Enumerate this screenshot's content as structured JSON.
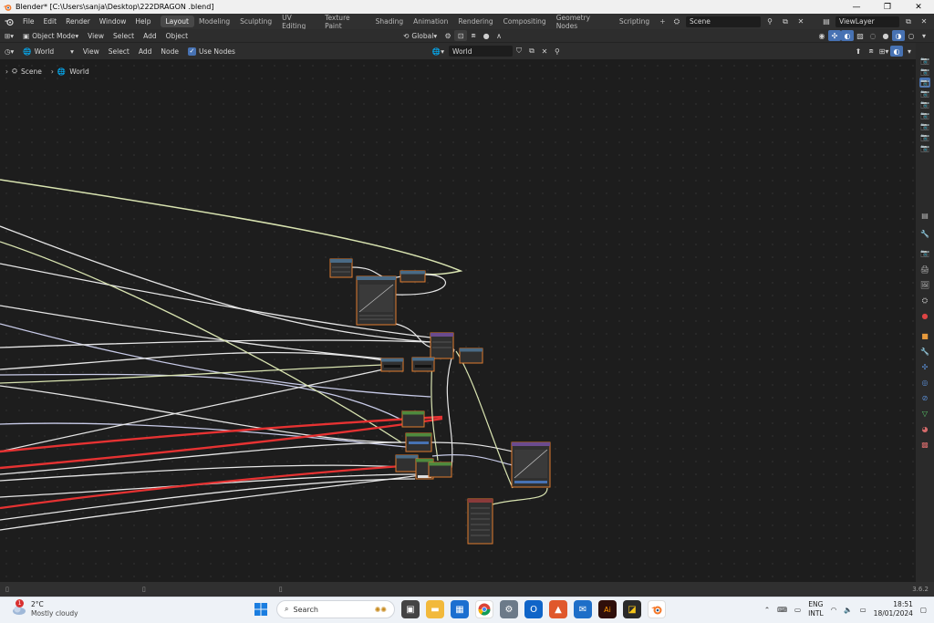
{
  "window": {
    "title": "Blender* [C:\\Users\\sanja\\Desktop\\222DRAGON .blend]",
    "minimize": "—",
    "maximize": "❐",
    "close": "✕"
  },
  "menu": [
    "File",
    "Edit",
    "Render",
    "Window",
    "Help"
  ],
  "workspaces": [
    {
      "label": "Layout",
      "active": true
    },
    {
      "label": "Modeling"
    },
    {
      "label": "Sculpting"
    },
    {
      "label": "UV Editing"
    },
    {
      "label": "Texture Paint"
    },
    {
      "label": "Shading"
    },
    {
      "label": "Animation"
    },
    {
      "label": "Rendering"
    },
    {
      "label": "Compositing"
    },
    {
      "label": "Geometry Nodes"
    },
    {
      "label": "Scripting"
    }
  ],
  "add_workspace": "+",
  "scene_field": "Scene",
  "viewlayer_field": "ViewLayer",
  "tool_header": {
    "mode": "Object Mode",
    "items": [
      "View",
      "Select",
      "Add",
      "Object"
    ],
    "transform": "Global"
  },
  "node_header": {
    "shader_type": "World",
    "items": [
      "View",
      "Select",
      "Add",
      "Node"
    ],
    "use_nodes_label": "Use Nodes",
    "use_nodes_checked": true,
    "world_field": "World"
  },
  "breadcrumb": [
    "Scene",
    "World"
  ],
  "status": {
    "version": "3.6.2"
  },
  "taskbar": {
    "weather_badge": "1",
    "temperature": "2°C",
    "weather_desc": "Mostly cloudy",
    "search_placeholder": "Search",
    "language": "ENG",
    "layout": "INTL",
    "time": "18:51",
    "date": "18/01/2024"
  },
  "colors": {
    "accent": "#4772b3",
    "active_tab": "#484848",
    "node_selected_border": "#e07b2e",
    "link_red": "#e63232",
    "link_white": "#dcdcdc",
    "link_lime": "#d8e3b0"
  }
}
